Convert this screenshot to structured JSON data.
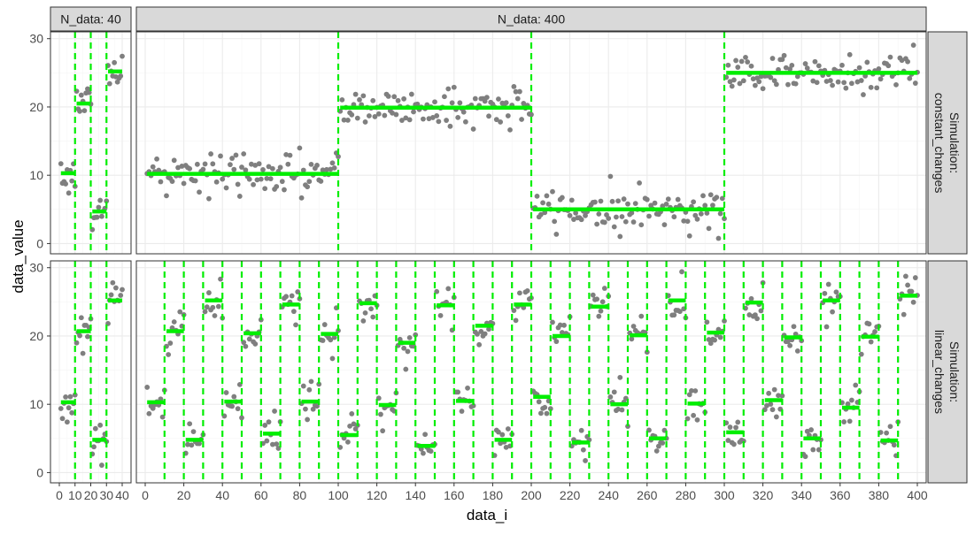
{
  "chart_data": {
    "type": "scatter",
    "xlabel": "data_i",
    "ylabel": "data_value",
    "column_facets": [
      {
        "label": "N_data: 40",
        "xlim": [
          0,
          40
        ],
        "xticks": [
          0,
          10,
          20,
          30,
          40
        ]
      },
      {
        "label": "N_data: 400",
        "xlim": [
          0,
          400
        ],
        "xticks": [
          0,
          20,
          40,
          60,
          80,
          100,
          120,
          140,
          160,
          180,
          200,
          220,
          240,
          260,
          280,
          300,
          320,
          340,
          360,
          380,
          400
        ]
      }
    ],
    "row_facets": [
      {
        "label_line1": "Simulation:",
        "label_line2": "constant_changes",
        "ylim": [
          -1.5,
          31
        ],
        "yticks": [
          0,
          10,
          20,
          30
        ]
      },
      {
        "label_line1": "Simulation:",
        "label_line2": "linear_changes",
        "ylim": [
          -1.5,
          31
        ],
        "yticks": [
          0,
          10,
          20,
          30
        ]
      }
    ],
    "panels": [
      {
        "row": 0,
        "col": 0,
        "changepoints": [
          10,
          20,
          30
        ],
        "segments": [
          {
            "start": 1,
            "end": 10,
            "mean": 10.3
          },
          {
            "start": 11,
            "end": 20,
            "mean": 20.5
          },
          {
            "start": 21,
            "end": 30,
            "mean": 4.7
          },
          {
            "start": 31,
            "end": 40,
            "mean": 25.2
          }
        ]
      },
      {
        "row": 0,
        "col": 1,
        "changepoints": [
          100,
          200,
          300
        ],
        "segments": [
          {
            "start": 1,
            "end": 100,
            "mean": 10.2
          },
          {
            "start": 101,
            "end": 200,
            "mean": 19.9
          },
          {
            "start": 201,
            "end": 300,
            "mean": 5.0
          },
          {
            "start": 301,
            "end": 400,
            "mean": 25.0
          }
        ]
      },
      {
        "row": 1,
        "col": 0,
        "changepoints": [
          10,
          20,
          30
        ],
        "segments": [
          {
            "start": 1,
            "end": 10,
            "mean": 10.3
          },
          {
            "start": 11,
            "end": 20,
            "mean": 20.7
          },
          {
            "start": 21,
            "end": 30,
            "mean": 4.8
          },
          {
            "start": 31,
            "end": 40,
            "mean": 25.2
          }
        ]
      },
      {
        "row": 1,
        "col": 1,
        "changepoints": [
          10,
          20,
          30,
          40,
          50,
          60,
          70,
          80,
          90,
          100,
          110,
          120,
          130,
          140,
          150,
          160,
          170,
          180,
          190,
          200,
          210,
          220,
          230,
          240,
          250,
          260,
          270,
          280,
          290,
          300,
          310,
          320,
          330,
          340,
          350,
          360,
          370,
          380,
          390
        ],
        "segments": [
          {
            "start": 1,
            "end": 10,
            "mean": 10.3
          },
          {
            "start": 11,
            "end": 20,
            "mean": 20.7
          },
          {
            "start": 21,
            "end": 30,
            "mean": 4.8
          },
          {
            "start": 31,
            "end": 40,
            "mean": 25.2
          },
          {
            "start": 41,
            "end": 50,
            "mean": 10.4
          },
          {
            "start": 51,
            "end": 60,
            "mean": 20.4
          },
          {
            "start": 61,
            "end": 70,
            "mean": 5.7
          },
          {
            "start": 71,
            "end": 80,
            "mean": 24.6
          },
          {
            "start": 81,
            "end": 90,
            "mean": 10.4
          },
          {
            "start": 91,
            "end": 100,
            "mean": 20.3
          },
          {
            "start": 101,
            "end": 110,
            "mean": 5.5
          },
          {
            "start": 111,
            "end": 120,
            "mean": 24.8
          },
          {
            "start": 121,
            "end": 130,
            "mean": 9.9
          },
          {
            "start": 131,
            "end": 140,
            "mean": 19.0
          },
          {
            "start": 141,
            "end": 150,
            "mean": 3.9
          },
          {
            "start": 151,
            "end": 160,
            "mean": 24.5
          },
          {
            "start": 161,
            "end": 170,
            "mean": 10.5
          },
          {
            "start": 171,
            "end": 180,
            "mean": 21.5
          },
          {
            "start": 181,
            "end": 190,
            "mean": 4.8
          },
          {
            "start": 191,
            "end": 200,
            "mean": 24.6
          },
          {
            "start": 201,
            "end": 210,
            "mean": 11.1
          },
          {
            "start": 211,
            "end": 220,
            "mean": 20.0
          },
          {
            "start": 221,
            "end": 230,
            "mean": 4.4
          },
          {
            "start": 231,
            "end": 240,
            "mean": 24.3
          },
          {
            "start": 241,
            "end": 250,
            "mean": 10.0
          },
          {
            "start": 251,
            "end": 260,
            "mean": 20.1
          },
          {
            "start": 261,
            "end": 270,
            "mean": 5.0
          },
          {
            "start": 271,
            "end": 280,
            "mean": 25.2
          },
          {
            "start": 281,
            "end": 290,
            "mean": 10.1
          },
          {
            "start": 291,
            "end": 300,
            "mean": 20.5
          },
          {
            "start": 301,
            "end": 310,
            "mean": 5.9
          },
          {
            "start": 311,
            "end": 320,
            "mean": 24.9
          },
          {
            "start": 321,
            "end": 330,
            "mean": 10.6
          },
          {
            "start": 331,
            "end": 340,
            "mean": 19.8
          },
          {
            "start": 341,
            "end": 350,
            "mean": 5.0
          },
          {
            "start": 351,
            "end": 360,
            "mean": 25.2
          },
          {
            "start": 361,
            "end": 370,
            "mean": 9.5
          },
          {
            "start": 371,
            "end": 380,
            "mean": 19.9
          },
          {
            "start": 381,
            "end": 390,
            "mean": 4.7
          },
          {
            "start": 391,
            "end": 400,
            "mean": 25.9
          }
        ]
      }
    ],
    "point_noise_sd": 1.5,
    "colors": {
      "points": "#7f7f7f",
      "fit_lines": "#00ee00",
      "changepoint_lines": "#00ee00",
      "strip_fill": "#d9d9d9",
      "panel_border": "#333333",
      "grid_major": "#ebebeb",
      "grid_minor": "#f5f5f5",
      "text": "#4d4d4d"
    },
    "grid": true
  }
}
